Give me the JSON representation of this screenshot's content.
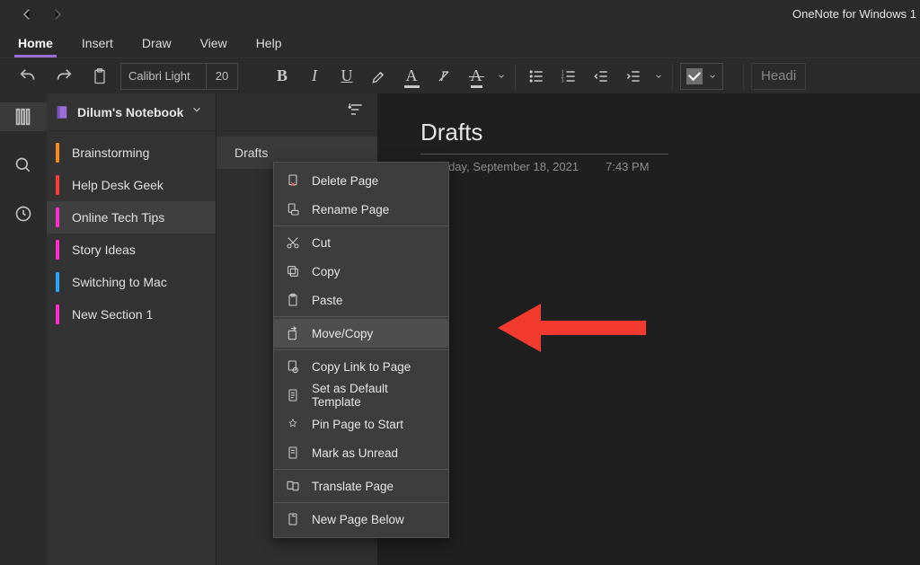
{
  "app_title": "OneNote for Windows 1",
  "ribbon": {
    "tabs": [
      "Home",
      "Insert",
      "Draw",
      "View",
      "Help"
    ],
    "active_tab": "Home",
    "font_name": "Calibri Light",
    "font_size": "20",
    "heading_label": "Headi"
  },
  "notebook": {
    "title": "Dilum's Notebook"
  },
  "sections": [
    {
      "label": "Brainstorming",
      "color": "#f58b1f",
      "active": false
    },
    {
      "label": "Help Desk Geek",
      "color": "#ff3b3b",
      "active": false
    },
    {
      "label": "Online Tech Tips",
      "color": "#ff2fd3",
      "active": true
    },
    {
      "label": "Story Ideas",
      "color": "#ff2fd3",
      "active": false
    },
    {
      "label": "Switching to Mac",
      "color": "#2aa6ff",
      "active": false
    },
    {
      "label": "New Section 1",
      "color": "#ff2fd3",
      "active": false
    }
  ],
  "pages": [
    {
      "label": "Drafts",
      "active": true
    }
  ],
  "page": {
    "title": "Drafts",
    "date": "Saturday, September 18, 2021",
    "time": "7:43 PM"
  },
  "context_menu": [
    {
      "label": "Delete Page",
      "icon": "delete-page-icon",
      "hover": false
    },
    {
      "label": "Rename Page",
      "icon": "rename-page-icon",
      "hover": false
    },
    {
      "label": "Cut",
      "icon": "cut-icon",
      "hover": false
    },
    {
      "label": "Copy",
      "icon": "copy-icon",
      "hover": false
    },
    {
      "label": "Paste",
      "icon": "paste-icon",
      "hover": false
    },
    {
      "label": "Move/Copy",
      "icon": "move-copy-icon",
      "hover": true
    },
    {
      "label": "Copy Link to Page",
      "icon": "copy-link-icon",
      "hover": false
    },
    {
      "label": "Set as Default Template",
      "icon": "template-icon",
      "hover": false
    },
    {
      "label": "Pin Page to Start",
      "icon": "pin-icon",
      "hover": false
    },
    {
      "label": "Mark as Unread",
      "icon": "unread-icon",
      "hover": false
    },
    {
      "label": "Translate Page",
      "icon": "translate-icon",
      "hover": false
    },
    {
      "label": "New Page Below",
      "icon": "new-page-icon",
      "hover": false
    }
  ]
}
